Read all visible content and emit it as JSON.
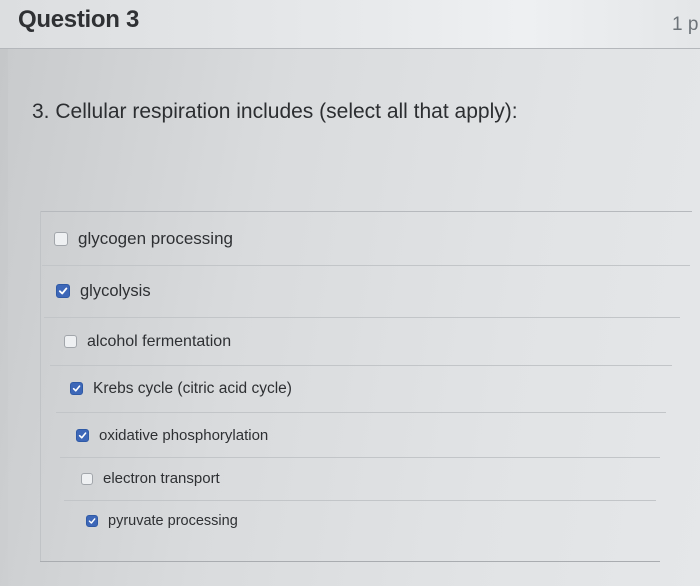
{
  "header": {
    "title": "Question 3",
    "points": "1 p"
  },
  "question": {
    "text": "3. Cellular respiration includes (select all that apply):"
  },
  "answers": [
    {
      "label": "glycogen processing",
      "checked": false
    },
    {
      "label": "glycolysis",
      "checked": true
    },
    {
      "label": "alcohol fermentation",
      "checked": false
    },
    {
      "label": "Krebs cycle (citric acid cycle)",
      "checked": true
    },
    {
      "label": "oxidative phosphorylation",
      "checked": true
    },
    {
      "label": "electron transport",
      "checked": false
    },
    {
      "label": "pyruvate processing",
      "checked": true
    }
  ],
  "colors": {
    "checkbox_checked": "#3d67b8",
    "text": "#2e3033"
  },
  "icons": {
    "checkmark": "check-icon"
  }
}
